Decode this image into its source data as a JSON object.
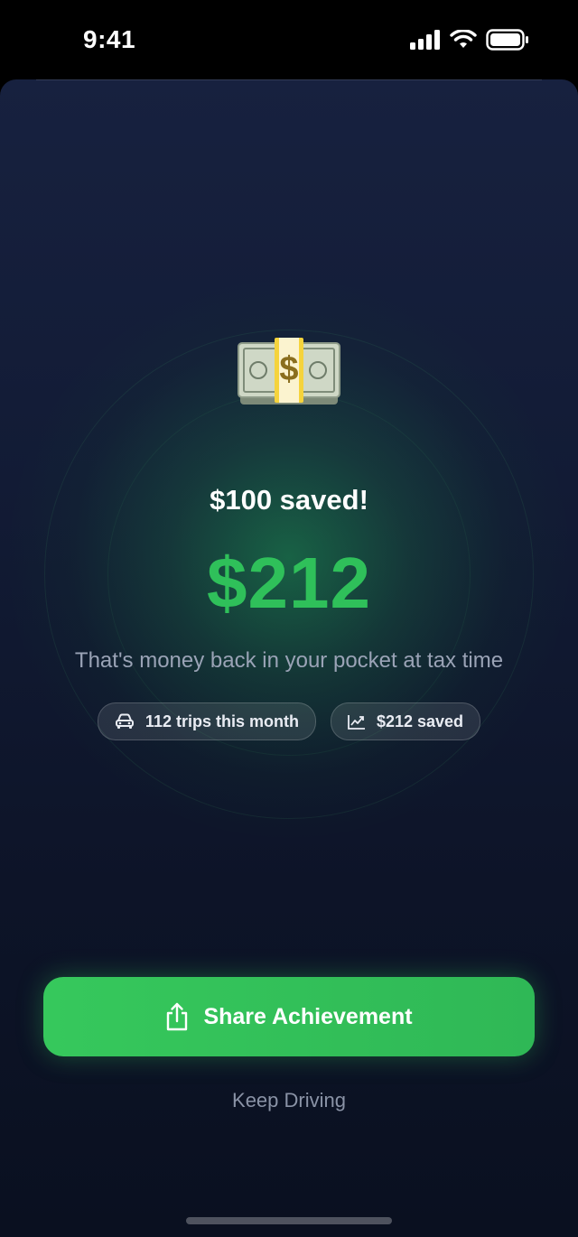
{
  "status_bar": {
    "time": "9:41"
  },
  "achievement": {
    "headline": "$100 saved!",
    "amount": "$212",
    "subtitle": "That's money back in your pocket at tax time"
  },
  "chips": [
    {
      "icon": "car-icon",
      "label": "112 trips this month"
    },
    {
      "icon": "trending-up-icon",
      "label": "$212 saved"
    }
  ],
  "actions": {
    "share_label": "Share Achievement",
    "keep_driving_label": "Keep Driving"
  },
  "colors": {
    "accent_green": "#34c759",
    "amount_green": "#2fc05a",
    "background": "#121b35"
  }
}
